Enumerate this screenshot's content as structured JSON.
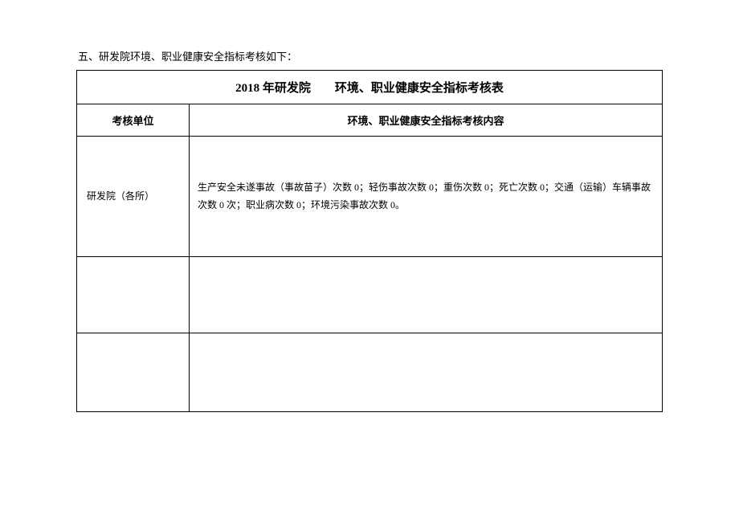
{
  "intro": "五、研发院环境、职业健康安全指标考核如下：",
  "table": {
    "title_part1": "2018 年研发院",
    "title_part2": "环境、职业健康安全指标考核表",
    "headers": {
      "unit": "考核单位",
      "content": "环境、职业健康安全指标考核内容"
    },
    "rows": [
      {
        "unit": "研发院（各所）",
        "content": "生产安全未遂事故（事故苗子）次数 0；轻伤事故次数 0；重伤次数 0；死亡次数 0；交通（运输）车辆事故次数 0 次；职业病次数 0；环境污染事故次数 0。"
      },
      {
        "unit": "",
        "content": ""
      },
      {
        "unit": "",
        "content": ""
      }
    ]
  }
}
